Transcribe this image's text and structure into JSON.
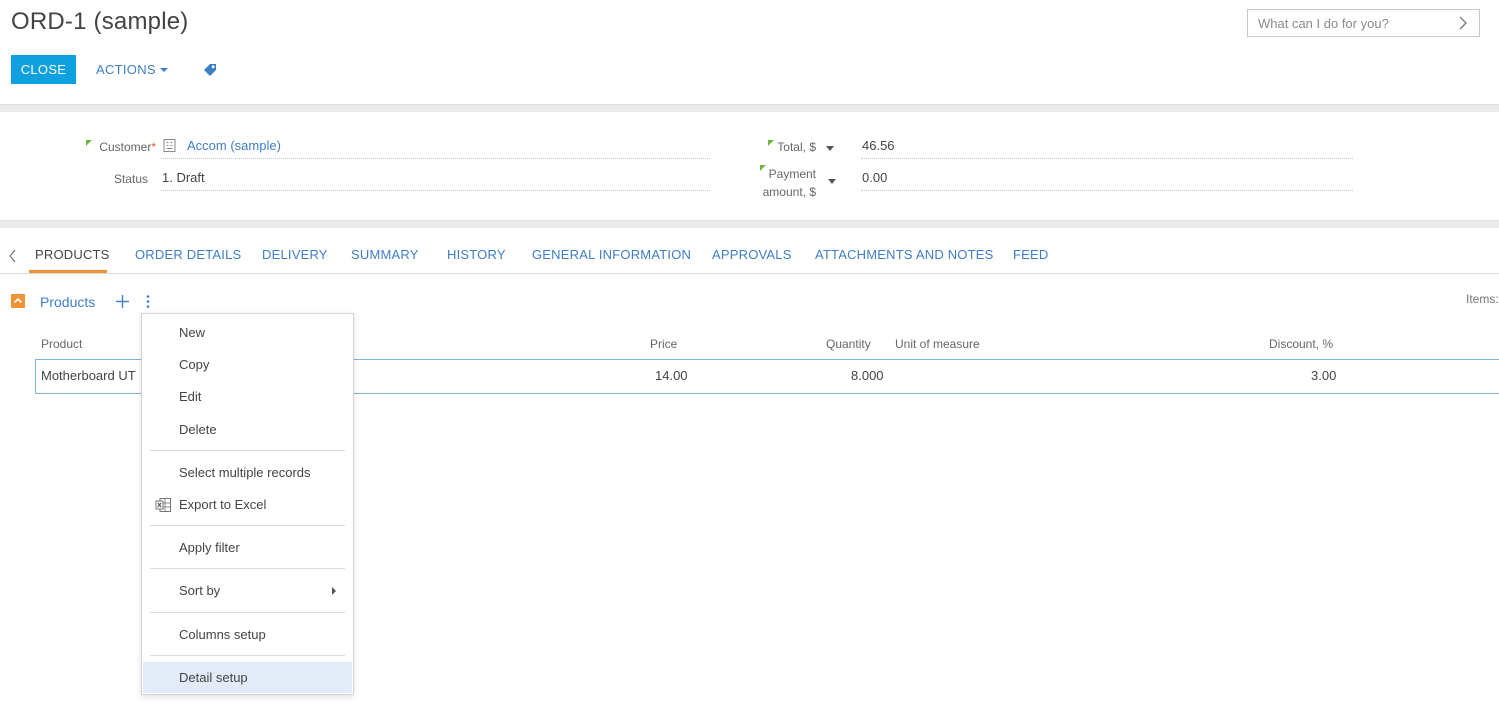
{
  "header": {
    "title": "ORD-1 (sample)",
    "search_placeholder": "What can I do for you?"
  },
  "toolbar": {
    "close_label": "CLOSE",
    "actions_label": "ACTIONS"
  },
  "fields": {
    "customer": {
      "label": "Customer",
      "required_mark": "*",
      "value": "Accom (sample)"
    },
    "status": {
      "label": "Status",
      "value": "1. Draft"
    },
    "total": {
      "label": "Total, $",
      "value": "46.56"
    },
    "payment": {
      "label_line1": "Payment",
      "label_line2": "amount, $",
      "value": "0.00"
    }
  },
  "tabs": [
    {
      "label": "PRODUCTS",
      "active": true
    },
    {
      "label": "ORDER DETAILS"
    },
    {
      "label": "DELIVERY"
    },
    {
      "label": "SUMMARY"
    },
    {
      "label": "HISTORY"
    },
    {
      "label": "GENERAL INFORMATION"
    },
    {
      "label": "APPROVALS"
    },
    {
      "label": "ATTACHMENTS AND NOTES"
    },
    {
      "label": "FEED"
    }
  ],
  "detail": {
    "title": "Products",
    "items_label": "Items:",
    "columns": [
      "Product",
      "Price",
      "Quantity",
      "Unit of measure",
      "Discount, %"
    ],
    "rows": [
      {
        "product": "Motherboard UT",
        "price": "14.00",
        "quantity": "8.000",
        "unit": "",
        "discount": "3.00"
      }
    ]
  },
  "context_menu": {
    "items": [
      "New",
      "Copy",
      "Edit",
      "Delete",
      "Select multiple records",
      "Export to Excel",
      "Apply filter",
      "Sort by",
      "Columns setup",
      "Detail setup"
    ],
    "highlighted": "Detail setup"
  },
  "colors": {
    "accent_blue": "#0fa0e0",
    "link_blue": "#3f7ec5",
    "tab_underline": "#f09136",
    "menu_highlight": "#e4ebf8",
    "required": "#e4542c",
    "changed_marker": "#6bb83a"
  },
  "icons": [
    "search-chevron-icon",
    "tag-icon",
    "account-icon",
    "dropdown-caret-icon",
    "tabs-scroll-left-icon",
    "collapse-icon",
    "plus-icon",
    "vertical-dots-icon",
    "excel-export-icon",
    "submenu-arrow-icon"
  ]
}
